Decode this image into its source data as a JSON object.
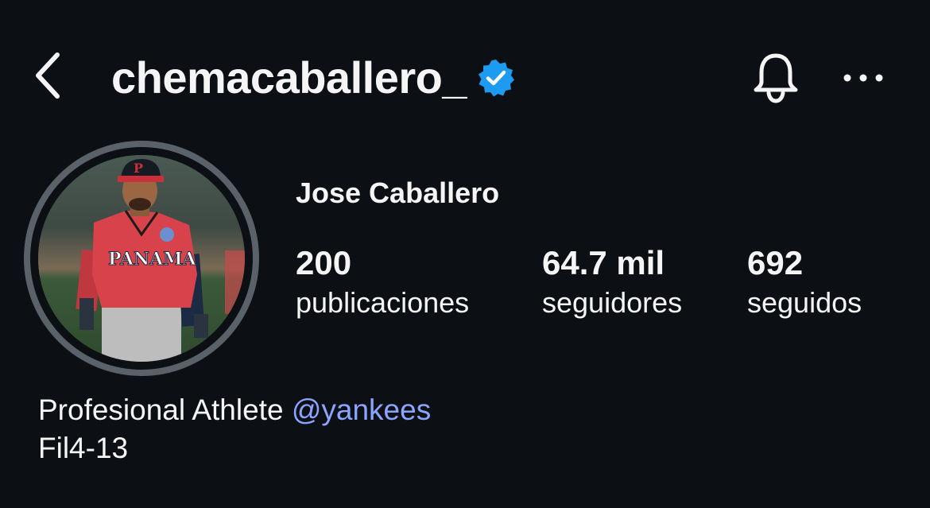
{
  "header": {
    "username": "chemacaballero_",
    "verified": true,
    "back_icon": "chevron-left-icon",
    "bell_icon": "bell-icon",
    "more_icon": "more-horizontal-icon",
    "verified_color": "#1d9bf0"
  },
  "profile": {
    "full_name": "Jose Caballero",
    "avatar_description_icon": "avatar",
    "stats": [
      {
        "value": "200",
        "label": "publicaciones"
      },
      {
        "value": "64.7 mil",
        "label": "seguidores"
      },
      {
        "value": "692",
        "label": "seguidos"
      }
    ]
  },
  "bio": {
    "line1_text": "Profesional Athlete ",
    "line1_mention": "@yankees",
    "line2": "Fil4-13",
    "mention_color": "#8ca4ff"
  },
  "colors": {
    "background": "#0c1014",
    "text": "#f5f5f5",
    "avatar_ring": "#5b6169"
  }
}
